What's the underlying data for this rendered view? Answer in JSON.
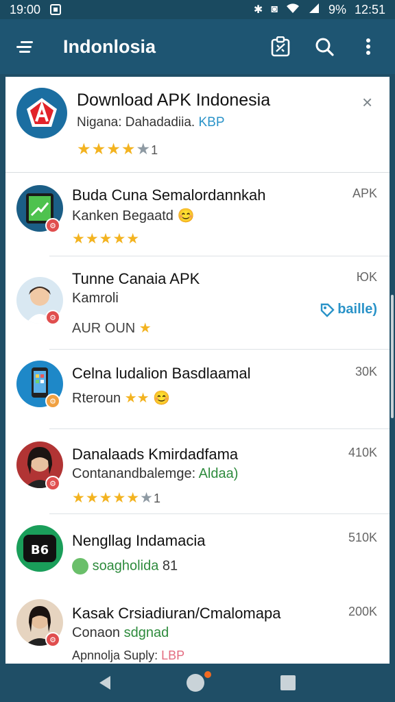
{
  "status_bar": {
    "time_left": "19:00",
    "battery": "9%",
    "clock": "12:51"
  },
  "app_bar": {
    "title": "Indonlosia"
  },
  "header": {
    "title": "Download APK Indonesia",
    "subtitle": "Nigana: Dahadadiia.",
    "subtitle_accent": "KBP",
    "stars_full": "★★★★",
    "stars_empty": "★",
    "rating_count": "1",
    "close": "×"
  },
  "items": [
    {
      "title": "Buda Cuna Semalordannkah",
      "subtitle": "Kanken Begaatd",
      "emoji": "😊",
      "count": "APK",
      "stars": "★★★★★"
    },
    {
      "title": "Tunne Canaia APK",
      "subtitle": "Kamroli",
      "count": "ЮK",
      "line3": "AUR OUN",
      "line3_star": "★",
      "link_label": "baille)"
    },
    {
      "title": "Celna ludalion Basdlaamal",
      "subtitle": "Rterоun",
      "count": "30K",
      "stars": "★★",
      "emoji": "😊"
    },
    {
      "title": "Danalaads Kmirdadfama",
      "subtitle": "Contanandbalemge:",
      "subtitle_accent": "Aldaa)",
      "count": "410K",
      "stars_full": "★★★★★",
      "stars_empty": "★",
      "rating_count": "1"
    },
    {
      "title": "Nengllag Indamacia",
      "subtitle": "soagholida",
      "subtitle_extra": "81",
      "count": "510K"
    },
    {
      "title": "Kasak Crsiadiuran/Cmalomapa",
      "subtitle": "Conaon",
      "subtitle_accent": "sdgnad",
      "count": "200K",
      "line3": "Apnnolja Suply:",
      "line3_accent": "LBP"
    }
  ],
  "colors": {
    "app_bar": "#1e5572",
    "accent_blue": "#2a93c8",
    "star": "#f3b320",
    "green": "#2e8b3d"
  }
}
